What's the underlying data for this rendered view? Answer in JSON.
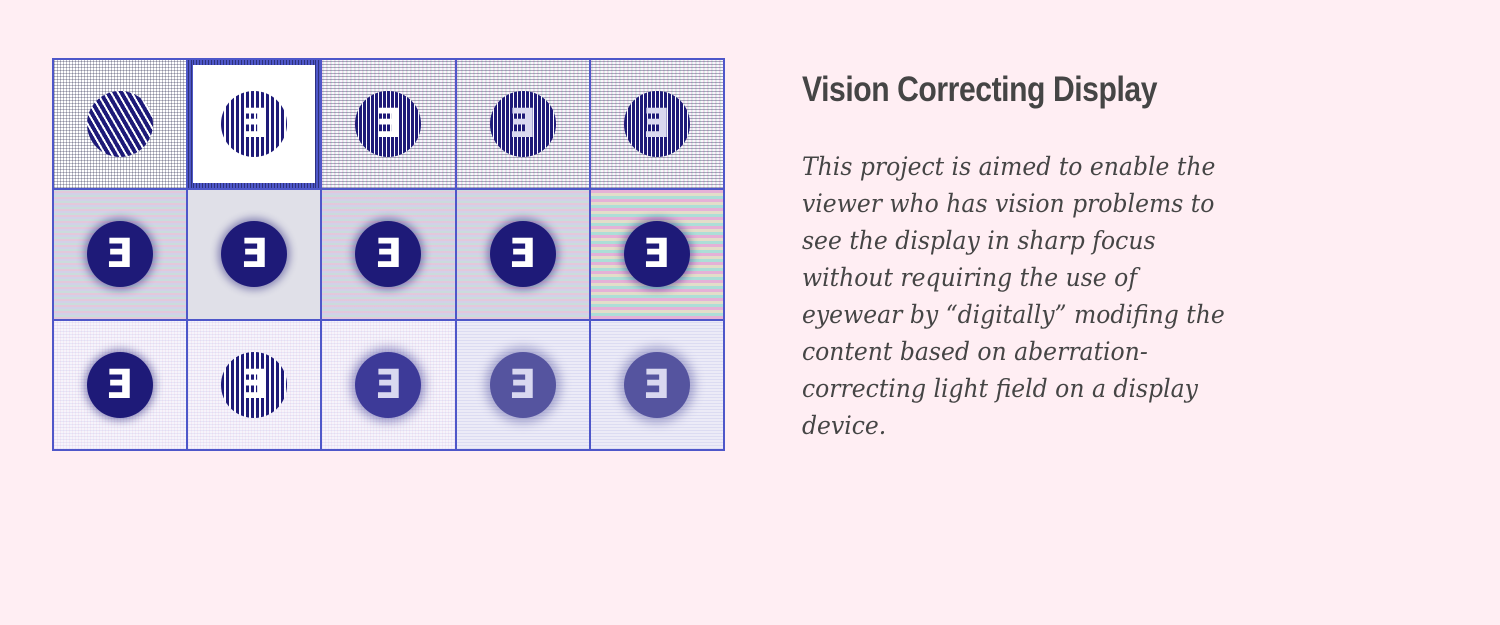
{
  "project": {
    "title": "Vision Correcting Display",
    "description": "This project is aimed to enable the viewer who has vision problems to see the display in sharp focus without requiring the use of eyewear by “digitally” modifing the content based on aberration-correcting light field on a display device."
  },
  "gallery": {
    "rows": 3,
    "columns": 5,
    "glyph": "E"
  },
  "colors": {
    "background": "#ffeef3",
    "text": "#454545",
    "grid_border": "#4e57c9",
    "disc": "#1e1a78"
  }
}
